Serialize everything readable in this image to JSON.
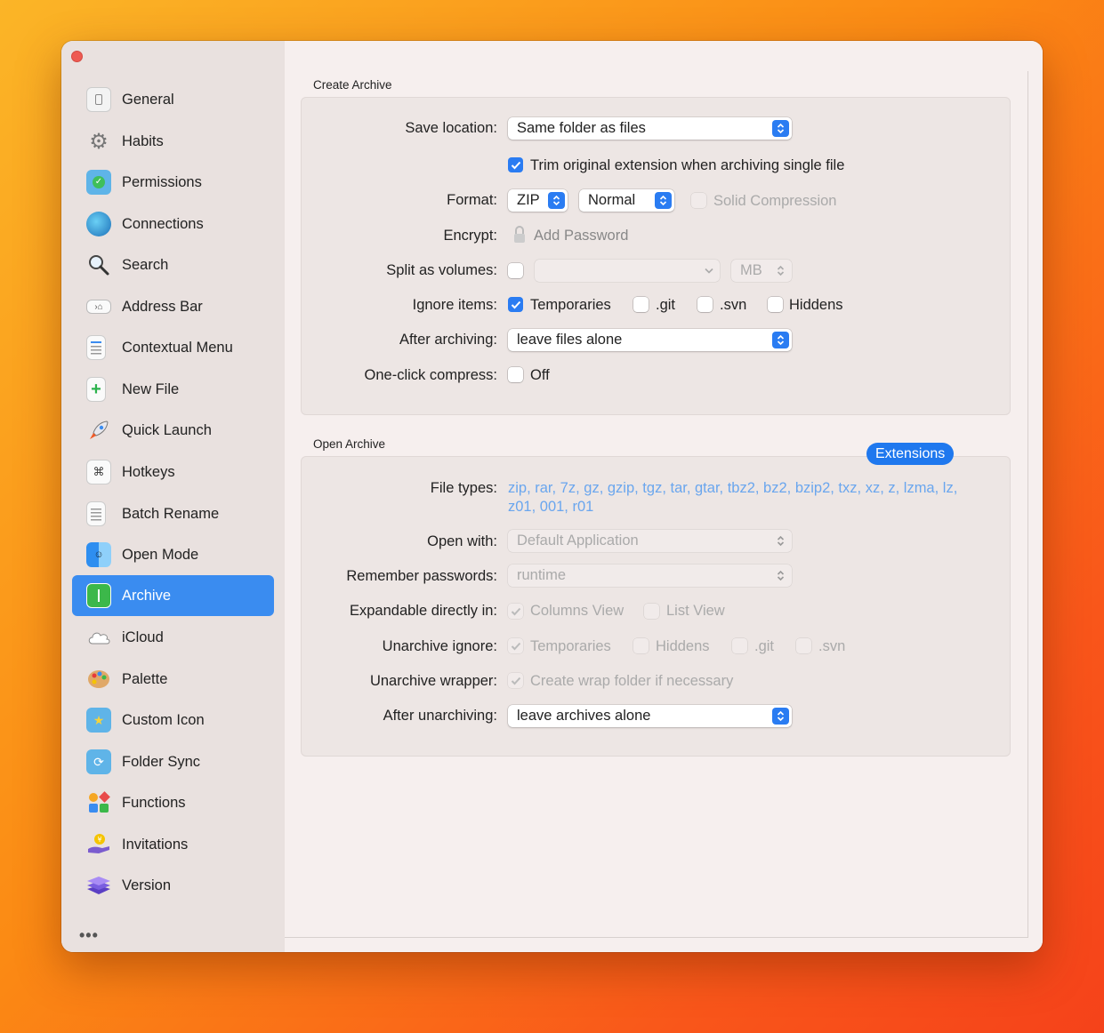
{
  "sidebar": {
    "items": [
      {
        "label": "General",
        "icon": "switch-icon"
      },
      {
        "label": "Habits",
        "icon": "gear-icon"
      },
      {
        "label": "Permissions",
        "icon": "folder-check-icon"
      },
      {
        "label": "Connections",
        "icon": "globe-icon"
      },
      {
        "label": "Search",
        "icon": "magnifier-icon"
      },
      {
        "label": "Address Bar",
        "icon": "address-bar-icon"
      },
      {
        "label": "Contextual Menu",
        "icon": "menu-list-icon"
      },
      {
        "label": "New File",
        "icon": "new-file-icon"
      },
      {
        "label": "Quick Launch",
        "icon": "rocket-icon"
      },
      {
        "label": "Hotkeys",
        "icon": "command-key-icon"
      },
      {
        "label": "Batch Rename",
        "icon": "document-list-icon"
      },
      {
        "label": "Open Mode",
        "icon": "finder-icon"
      },
      {
        "label": "Archive",
        "icon": "archive-icon"
      },
      {
        "label": "iCloud",
        "icon": "cloud-icon"
      },
      {
        "label": "Palette",
        "icon": "palette-icon"
      },
      {
        "label": "Custom Icon",
        "icon": "folder-star-icon"
      },
      {
        "label": "Folder Sync",
        "icon": "folder-sync-icon"
      },
      {
        "label": "Functions",
        "icon": "shapes-icon"
      },
      {
        "label": "Invitations",
        "icon": "coin-hand-icon"
      },
      {
        "label": "Version",
        "icon": "layers-icon"
      }
    ],
    "active": "Archive",
    "more": "•••"
  },
  "create_archive": {
    "title": "Create Archive",
    "save_location_label": "Save location:",
    "save_location_value": "Same folder as files",
    "trim_label": "Trim original extension when archiving single file",
    "trim_checked": true,
    "format_label": "Format:",
    "format_value": "ZIP",
    "level_value": "Normal",
    "solid_label": "Solid Compression",
    "encrypt_label": "Encrypt:",
    "add_password": "Add Password",
    "split_label": "Split as volumes:",
    "split_unit": "MB",
    "ignore_label": "Ignore items:",
    "ignore_options": [
      {
        "label": "Temporaries",
        "checked": true
      },
      {
        "label": ".git",
        "checked": false
      },
      {
        "label": ".svn",
        "checked": false
      },
      {
        "label": "Hiddens",
        "checked": false
      }
    ],
    "after_label": "After archiving:",
    "after_value": "leave files alone",
    "oneclick_label": "One-click compress:",
    "oneclick_value": "Off"
  },
  "open_archive": {
    "title": "Open Archive",
    "extensions_button": "Extensions",
    "file_types_label": "File types:",
    "file_types_line1": "zip, rar, 7z, gz, gzip, tgz, tar, gtar, tbz2, bz2, bzip2, txz, xz, z, lzma, lz,",
    "file_types_line2": "z01, 001, r01",
    "open_with_label": "Open with:",
    "open_with_value": "Default Application",
    "remember_label": "Remember passwords:",
    "remember_value": "runtime",
    "expandable_label": "Expandable directly in:",
    "expandable_options": [
      {
        "label": "Columns View",
        "checked": true
      },
      {
        "label": "List View",
        "checked": false
      }
    ],
    "unarchive_ignore_label": "Unarchive ignore:",
    "unarchive_ignore_options": [
      {
        "label": "Temporaries",
        "checked": true
      },
      {
        "label": "Hiddens",
        "checked": false
      },
      {
        "label": ".git",
        "checked": false
      },
      {
        "label": ".svn",
        "checked": false
      }
    ],
    "wrapper_label": "Unarchive wrapper:",
    "wrapper_option": "Create wrap folder if necessary",
    "after_label": "After unarchiving:",
    "after_value": "leave archives alone"
  },
  "colors": {
    "accent": "#2a7cf2",
    "selection": "#3a8cf0",
    "link": "#6aa6ee"
  }
}
